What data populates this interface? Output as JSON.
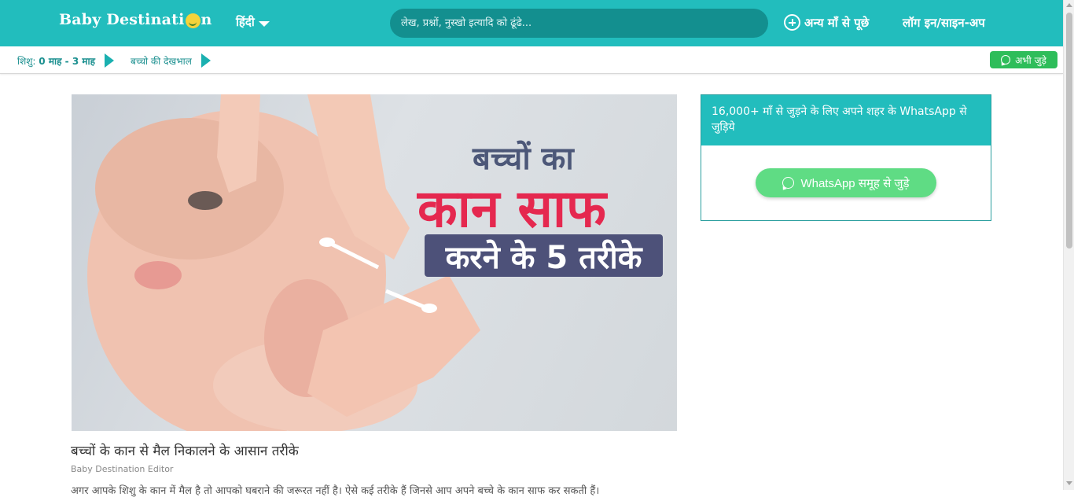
{
  "header": {
    "logo_text": "Baby Destinati",
    "logo_text_end": "n",
    "language_label": "हिंदी",
    "search_placeholder": "लेख, प्रश्नों, नुस्खो इत्यादि को ढूंढे...",
    "ask_label": "अन्य माँ से पूछे",
    "login_label": "लॉग इन/साइन-अप"
  },
  "subnav": {
    "crumb1_prefix": "शिशु: ",
    "crumb1_value": "0 माह - 3 माह",
    "crumb2": "बच्चो की देखभाल",
    "join_now": "अभी जुड़े"
  },
  "hero": {
    "line1": "बच्चों का",
    "line2": "कान साफ",
    "line3": "करने के 5 तरीके"
  },
  "article": {
    "title": "बच्चों के कान से मैल निकालने के आसान तरीके",
    "author": "Baby Destination Editor",
    "teaser": "अगर आपके शिशु के कान में मैल है तो आपको घबराने की जरूरत नहीं है। ऐसे कई तरीके हैं जिनसे आप अपने बच्चे के कान साफ कर सकती हैं।"
  },
  "sidebar": {
    "whatsapp_card_title": "16,000+ माँ से जुड़ने के लिए अपने शहर के WhatsApp से जुड़िये",
    "whatsapp_button": "WhatsApp समूह से जुड़े"
  },
  "colors": {
    "brand_teal": "#22bdbd",
    "search_bg": "#138f8f",
    "whatsapp_green": "#2ebd5a",
    "hero_pink": "#e5284f",
    "hero_navy": "#4d5179"
  }
}
